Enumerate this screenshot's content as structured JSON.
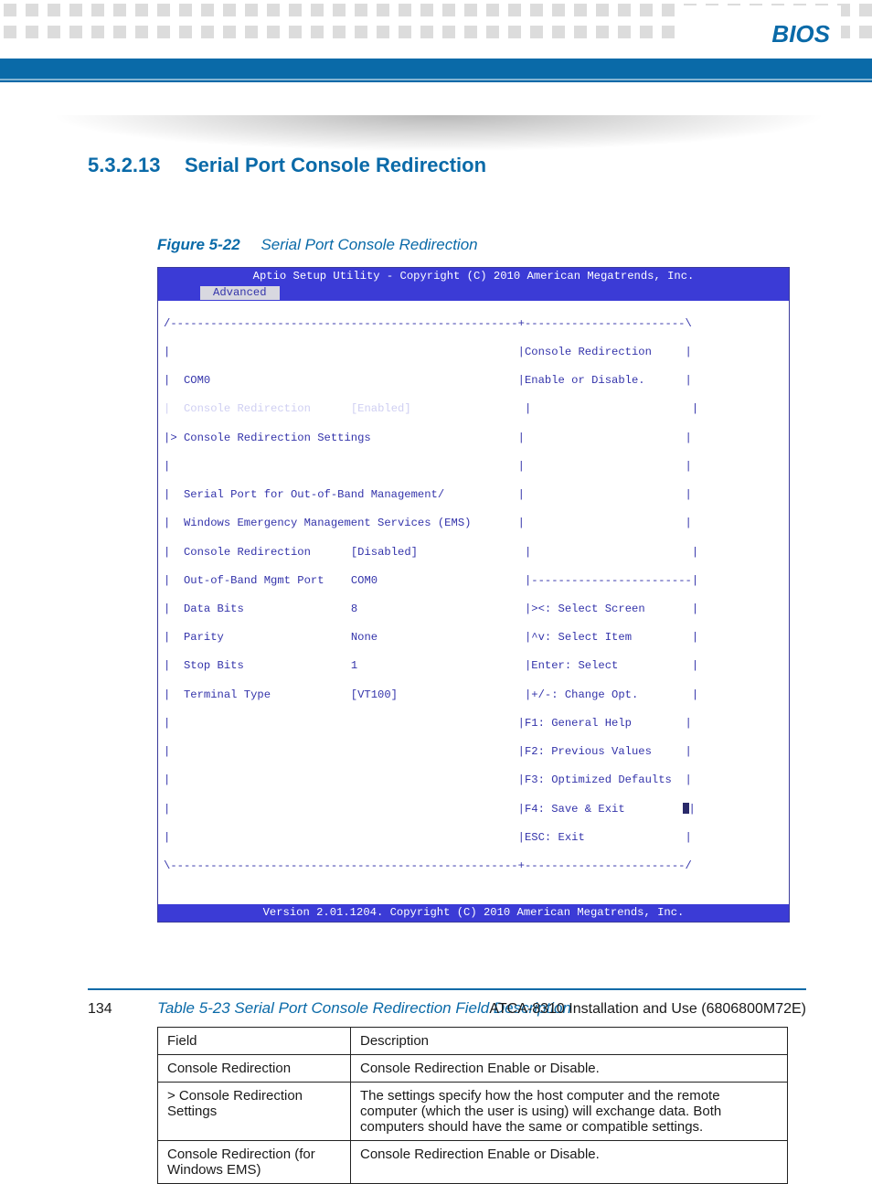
{
  "header": {
    "title": "BIOS"
  },
  "section": {
    "number": "5.3.2.13",
    "title": "Serial Port Console Redirection"
  },
  "figure": {
    "label": "Figure 5-22",
    "caption": "Serial Port Console Redirection"
  },
  "bios": {
    "topbar": "Aptio Setup Utility - Copyright (C) 2010 American Megatrends, Inc.",
    "tab": "Advanced",
    "left": {
      "com": "COM0",
      "cr_label": "Console Redirection",
      "cr_value": "[Enabled]",
      "cr_settings": "> Console Redirection Settings",
      "sp_line1": "Serial Port for Out-of-Band Management/",
      "sp_line2": "Windows Emergency Management Services (EMS)",
      "cr2_label": "Console Redirection",
      "cr2_value": "[Disabled]",
      "oob_label": "Out-of-Band Mgmt Port",
      "oob_value": "COM0",
      "db_label": "Data Bits",
      "db_value": "8",
      "par_label": "Parity",
      "par_value": "None",
      "sb_label": "Stop Bits",
      "sb_value": "1",
      "tt_label": "Terminal Type",
      "tt_value": "[VT100]"
    },
    "right": {
      "help1": "Console Redirection",
      "help2": "Enable or Disable.",
      "k1": "><: Select Screen",
      "k2": "^v: Select Item",
      "k3": "Enter: Select",
      "k4": "+/-: Change Opt.",
      "k5": "F1: General Help",
      "k6": "F2: Previous Values",
      "k7": "F3: Optimized Defaults",
      "k8": "F4: Save & Exit",
      "k9": "ESC: Exit"
    },
    "bottombar": "Version 2.01.1204. Copyright (C) 2010 American Megatrends, Inc."
  },
  "table": {
    "caption": "Table 5-23 Serial Port Console Redirection Field Description",
    "head": {
      "c1": "Field",
      "c2": "Description"
    },
    "rows": [
      {
        "c1": "Console Redirection",
        "c2": "Console Redirection Enable or Disable."
      },
      {
        "c1": "> Console Redirection Settings",
        "c2": "The settings specify how the host computer and the remote computer (which the user is using) will exchange data. Both computers should have the same or compatible settings."
      },
      {
        "c1": "Console Redirection (for Windows EMS)",
        "c2": "Console Redirection Enable or Disable."
      }
    ]
  },
  "footer": {
    "page": "134",
    "doc": "ATCA-8310 Installation and Use (6806800M72E)"
  }
}
